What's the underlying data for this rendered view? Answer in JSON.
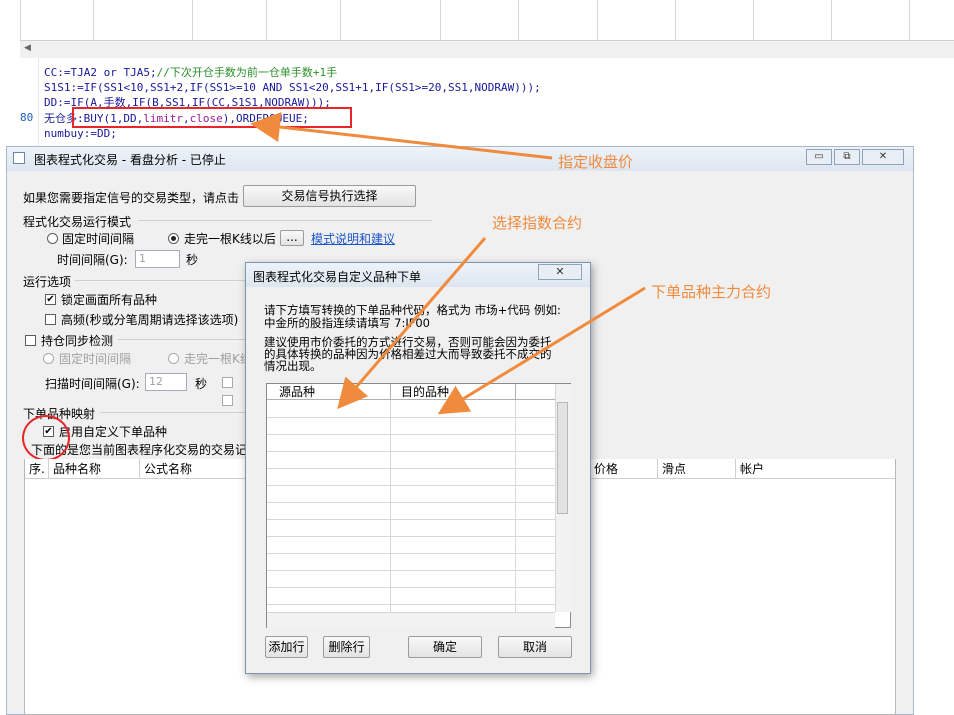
{
  "editor": {
    "line_number": "80",
    "line1_code": "CC:=TJA2 or TJA5;",
    "line1_comment": "//下次开仓手数为前一仓单手数+1手",
    "line2": "S1S1:=IF(SS1<10,SS1+2,IF(SS1>=10 AND SS1<20,SS1+1,IF(SS1>=20,SS1,NODRAW)));",
    "line3": "DD:=IF(A,手数,IF(B,SS1,IF(CC,S1S1,NODRAW)));",
    "line4_prefix": "无仓多:BUY(1,DD,",
    "line4_limitr": "limitr",
    "line4_comma": ",",
    "line4_close": "close",
    "line4_suffix": "),ORDERQUEUE;",
    "line5": "numbuy:=DD;"
  },
  "main_window": {
    "title": "图表程式化交易 - 看盘分析 - 已停止",
    "minimize_icon": "▭",
    "restore_icon": "⧉",
    "close_icon": "✕",
    "signal_prompt": "如果您需要指定信号的交易类型，请点击",
    "signal_button": "交易信号执行选择",
    "mode_group": "程式化交易运行模式",
    "fixed_interval": "固定时间间隔",
    "after_kline": "走完一根K线以后",
    "ellipsis_button": "...",
    "mode_help_link": "模式说明和建议",
    "interval_label": "时间间隔(G):",
    "interval_value": "1",
    "seconds_unit": "秒",
    "run_options_group": "运行选项",
    "lock_all": "锁定画面所有品种",
    "hf_mode": "高频(秒或分笔周期请选择该选项)",
    "position_sync": "持仓同步检测",
    "sync_fixed": "固定时间间隔",
    "sync_after_kline": "走完一根K线",
    "scan_interval_label": "扫描时间间隔(G):",
    "scan_interval_value": "12",
    "scan_seconds_unit": "秒",
    "mapping_group": "下单品种映射",
    "enable_custom": "启用自定义下单品种",
    "table_caption": "下面的是您当前图表程序化交易的交易记",
    "table_headers": [
      "序.",
      "品种名称",
      "公式名称",
      "价格",
      "滑点",
      "帐户"
    ]
  },
  "dialog": {
    "title": "图表程式化交易自定义品种下单",
    "close_icon": "✕",
    "instruction_line1": "请下方填写转换的下单品种代码，格式为 市场+代码 例如:",
    "instruction_line2": "中金所的股指连续请填写 7:IF00",
    "advice_line1": "建议使用市价委托的方式进行交易，否则可能会因为委托",
    "advice_line2": "的具体转换的品种因为价格相差过大而导致委托不成交的",
    "advice_line3": "情况出现。",
    "col_source": "源品种",
    "col_target": "目的品种",
    "add_row": "添加行",
    "delete_row": "删除行",
    "ok": "确定",
    "cancel": "取消"
  },
  "annotations": {
    "close_price": "指定收盘价",
    "index_contract": "选择指数合约",
    "main_contract": "下单品种主力合约"
  },
  "colors": {
    "annotation": "#f08a3c",
    "highlight": "#e8262a",
    "link": "#1b55c9"
  }
}
